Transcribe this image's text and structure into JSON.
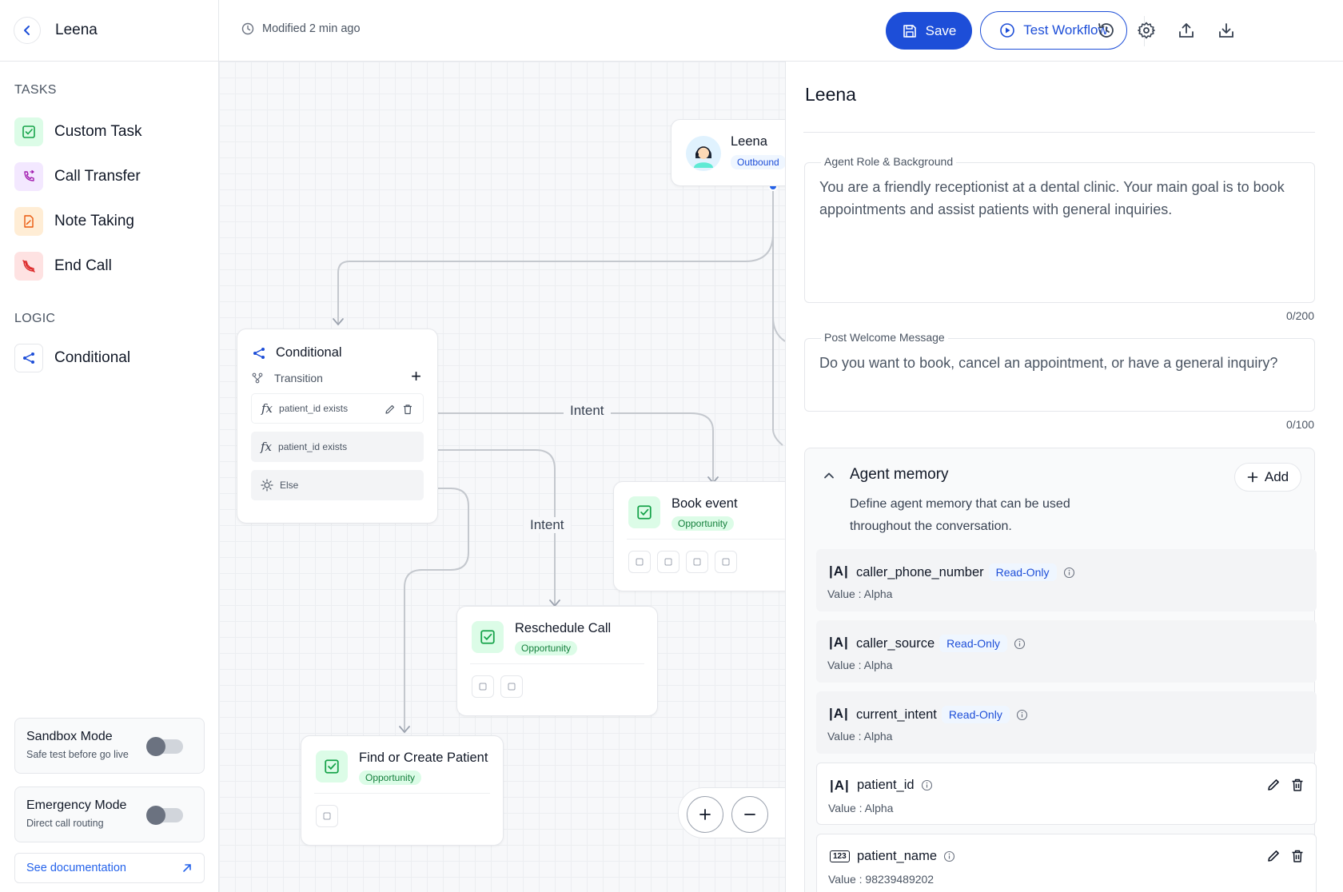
{
  "sidebar": {
    "title": "Leena",
    "sections": {
      "tasks": "TASKS",
      "logic": "LOGIC"
    },
    "tasks": [
      {
        "label": "Custom Task",
        "icon": "checkbox-icon"
      },
      {
        "label": "Call Transfer",
        "icon": "phone-transfer-icon"
      },
      {
        "label": "Note Taking",
        "icon": "note-icon"
      },
      {
        "label": "End Call",
        "icon": "phone-hangup-icon"
      }
    ],
    "logic": [
      {
        "label": "Conditional",
        "icon": "branch-icon"
      }
    ],
    "sandbox": {
      "title": "Sandbox Mode",
      "subtitle": "Safe test before go live"
    },
    "emergency": {
      "title": "Emergency Mode",
      "subtitle": "Direct call routing"
    },
    "docs_link": "See documentation"
  },
  "topbar": {
    "modified": "Modified 2 min ago",
    "save_label": "Save",
    "test_label": "Test Workflow",
    "icons": [
      "history-icon",
      "settings-icon",
      "upload-icon",
      "download-icon"
    ]
  },
  "canvas": {
    "agent_node": {
      "name": "Leena",
      "badge": "Outbound"
    },
    "conditional_node": {
      "title": "Conditional",
      "transition": "Transition",
      "rows": [
        "patient_id exists",
        "patient_id exists",
        "Else"
      ]
    },
    "edge_labels": [
      "Intent",
      "Intent"
    ],
    "task_nodes": [
      {
        "title": "Book event",
        "badge": "Opportunity"
      },
      {
        "title": "Reschedule Call",
        "badge": "Opportunity"
      },
      {
        "title": "Find or Create Patient",
        "badge": "Opportunity"
      }
    ]
  },
  "panel": {
    "title": "Leena",
    "role": {
      "label": "Agent Role & Background",
      "value": "You are a friendly receptionist at a dental clinic. Your main goal is to book appointments and assist patients with general inquiries.",
      "counter": "0/200"
    },
    "welcome": {
      "label": "Post Welcome Message",
      "value": "Do you want to book, cancel an appointment, or have a general inquiry?",
      "counter": "0/100"
    },
    "memory": {
      "title": "Agent memory",
      "description": "Define agent memory that can be used throughout the conversation.",
      "add_label": "Add",
      "items": [
        {
          "type": "|A|",
          "name": "caller_phone_number",
          "badge": "Read-Only",
          "value": "Value : Alpha"
        },
        {
          "type": "|A|",
          "name": "caller_source",
          "badge": "Read-Only",
          "value": "Value : Alpha"
        },
        {
          "type": "|A|",
          "name": "current_intent",
          "badge": "Read-Only",
          "value": "Value : Alpha"
        },
        {
          "type": "|A|",
          "name": "patient_id",
          "value": "Value : Alpha"
        },
        {
          "type": "123",
          "name": "patient_name",
          "value": "Value : 98239489202"
        }
      ]
    }
  },
  "colors": {
    "primary": "#1d4ed8",
    "success": "#15803d",
    "success_bg": "#dcfce7",
    "danger": "#dc2626"
  }
}
